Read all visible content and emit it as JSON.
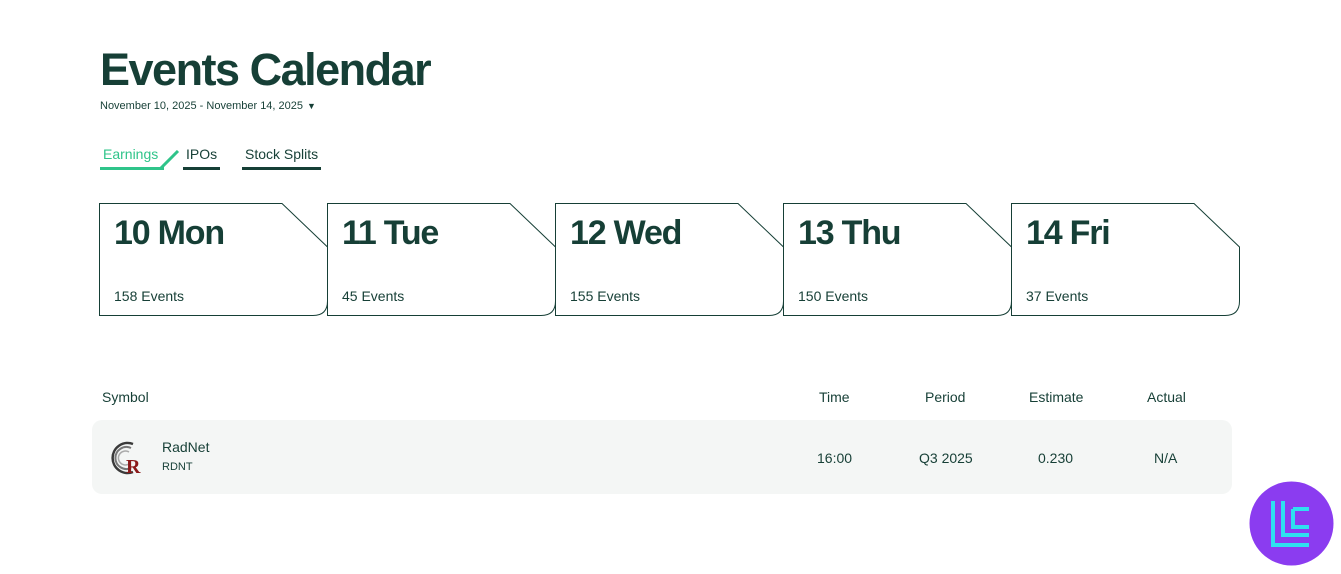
{
  "page": {
    "title": "Events Calendar",
    "date_range": "November 10, 2025 - November 14, 2025",
    "date_range_caret": "▼"
  },
  "tabs": [
    {
      "label": "Earnings",
      "active": true
    },
    {
      "label": "IPOs",
      "active": false
    },
    {
      "label": "Stock Splits",
      "active": false
    }
  ],
  "days": [
    {
      "title": "10 Mon",
      "count": "158 Events"
    },
    {
      "title": "11 Tue",
      "count": "45 Events"
    },
    {
      "title": "12 Wed",
      "count": "155 Events"
    },
    {
      "title": "13 Thu",
      "count": "150 Events"
    },
    {
      "title": "14 Fri",
      "count": "37 Events"
    }
  ],
  "table": {
    "headers": {
      "symbol": "Symbol",
      "time": "Time",
      "period": "Period",
      "estimate": "Estimate",
      "actual": "Actual"
    },
    "rows": [
      {
        "logo_icon": "radnet-logo-icon",
        "name": "RadNet",
        "ticker": "RDNT",
        "time": "16:00",
        "period": "Q3 2025",
        "estimate": "0.230",
        "actual": "N/A"
      }
    ]
  },
  "badge": {
    "icon": "brand-logo-icon"
  },
  "colors": {
    "primary": "#163f36",
    "accent_green": "#2fc48a",
    "row_bg": "#f4f6f5",
    "badge_purple": "#8b3cf0",
    "badge_cyan": "#2ee0f0",
    "radnet_red": "#8b1a1a"
  }
}
